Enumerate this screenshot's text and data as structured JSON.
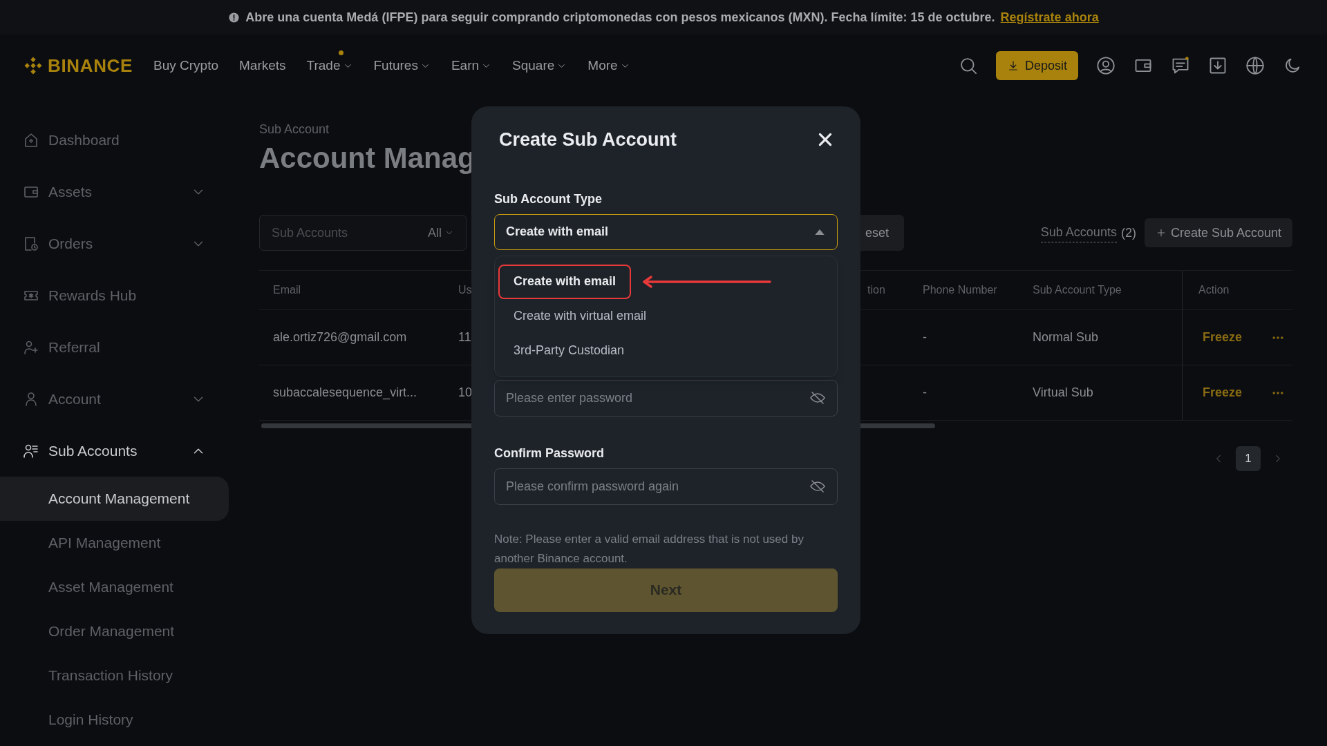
{
  "banner": {
    "text": "Abre una cuenta Medá (IFPE) para seguir comprando criptomonedas con pesos mexicanos (MXN). Fecha límite: 15 de octubre.",
    "link": "Regístrate ahora"
  },
  "nav": {
    "logo": "BINANCE",
    "items": [
      {
        "label": "Buy Crypto",
        "dropdown": false,
        "dot": false
      },
      {
        "label": "Markets",
        "dropdown": false,
        "dot": false
      },
      {
        "label": "Trade",
        "dropdown": true,
        "dot": true
      },
      {
        "label": "Futures",
        "dropdown": true,
        "dot": false
      },
      {
        "label": "Earn",
        "dropdown": true,
        "dot": false
      },
      {
        "label": "Square",
        "dropdown": true,
        "dot": false
      },
      {
        "label": "More",
        "dropdown": true,
        "dot": false
      }
    ],
    "deposit": "Deposit"
  },
  "sidebar": {
    "items": [
      {
        "label": "Dashboard",
        "kind": "link",
        "selected": false
      },
      {
        "label": "Assets",
        "kind": "group",
        "selected": false,
        "expanded": false
      },
      {
        "label": "Orders",
        "kind": "group",
        "selected": false,
        "expanded": false
      },
      {
        "label": "Rewards Hub",
        "kind": "link",
        "selected": false
      },
      {
        "label": "Referral",
        "kind": "link",
        "selected": false
      },
      {
        "label": "Account",
        "kind": "group",
        "selected": false,
        "expanded": false
      },
      {
        "label": "Sub Accounts",
        "kind": "group",
        "selected": true,
        "expanded": true,
        "children": [
          {
            "label": "Account Management",
            "selected": true
          },
          {
            "label": "API Management",
            "selected": false
          },
          {
            "label": "Asset Management",
            "selected": false
          },
          {
            "label": "Order Management",
            "selected": false
          },
          {
            "label": "Transaction History",
            "selected": false
          },
          {
            "label": "Login History",
            "selected": false
          }
        ]
      }
    ]
  },
  "page": {
    "breadcrumb": "Sub Account",
    "title": "Account Manag",
    "filter": {
      "placeholder": "Sub Accounts",
      "select": "All",
      "reset_button": "eset"
    },
    "sub_accounts_link": "Sub Accounts",
    "count": "(2)",
    "create_button": "Create Sub Account"
  },
  "table": {
    "columns": [
      "Email",
      "Us",
      "tion",
      "Phone Number",
      "Sub Account Type",
      "Action"
    ],
    "rows": [
      {
        "email": "ale.ortiz726@gmail.com",
        "column_2": "11",
        "phone": "-",
        "type": "Normal Sub",
        "action": "Freeze"
      },
      {
        "email": "subaccalesequence_virt...",
        "column_2": "10",
        "phone": "-",
        "type": "Virtual Sub",
        "action": "Freeze"
      }
    ]
  },
  "pagination": {
    "pages": [
      {
        "label": "1",
        "selected": true
      }
    ]
  },
  "modal": {
    "title": "Create Sub Account",
    "type_label": "Sub Account Type",
    "type_value": "Create with email",
    "expanded": true,
    "options": [
      {
        "label": "Create with email",
        "selected": true,
        "annotated": true
      },
      {
        "label": "Create with virtual email",
        "selected": false,
        "annotated": false
      },
      {
        "label": "3rd-Party Custodian",
        "selected": false,
        "annotated": false
      }
    ],
    "password_placeholder": "Please enter password",
    "confirm_label": "Confirm Password",
    "confirm_placeholder": "Please confirm password again",
    "note": "Note: Please enter a valid email address that is not used by another Binance account.",
    "next": "Next"
  }
}
